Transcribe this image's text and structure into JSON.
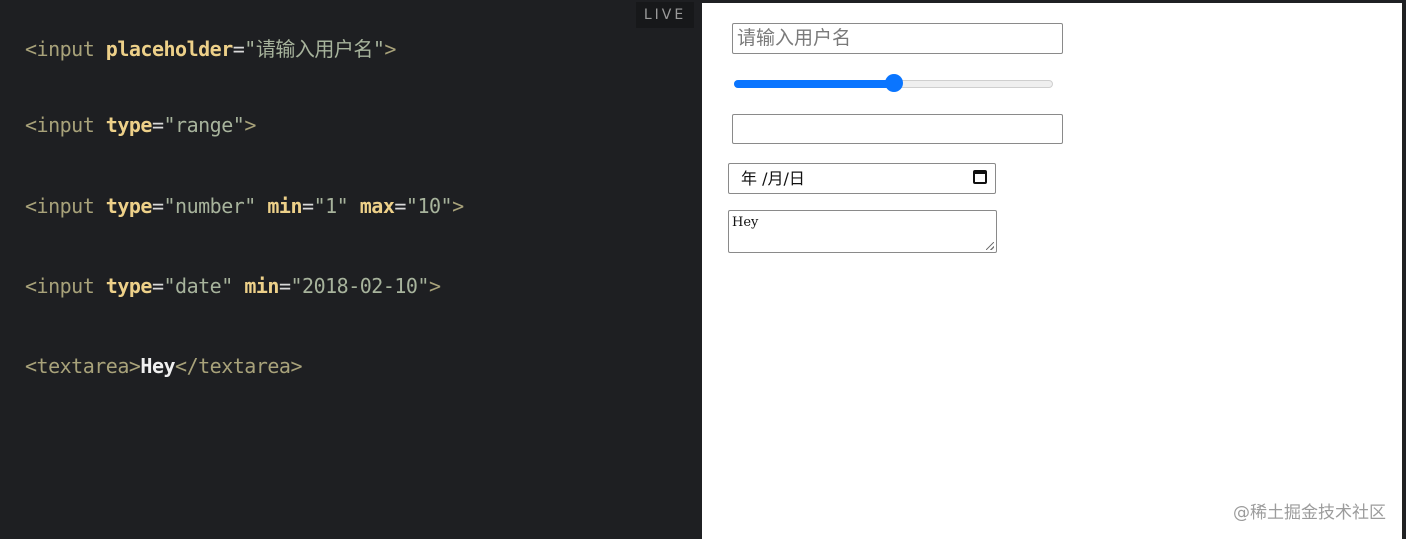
{
  "editor": {
    "lines": [
      {
        "open": "<input ",
        "attr1": "placeholder",
        "val1": "\"请输入用户名\"",
        "close": ">"
      },
      {
        "open": "<input ",
        "attr1": "type",
        "val1": "\"range\"",
        "close": ">"
      },
      {
        "open": "<input ",
        "attr1": "type",
        "val1": "\"number\"",
        "attr2": "min",
        "val2": "\"1\"",
        "attr3": "max",
        "val3": "\"10\"",
        "close": ">"
      },
      {
        "open": "<input ",
        "attr1": "type",
        "val1": "\"date\"",
        "attr2": "min",
        "val2": "\"2018-02-10\"",
        "close": ">"
      },
      {
        "open": "<textarea>",
        "text": "Hey",
        "close": "</textarea>"
      }
    ],
    "eq": "="
  },
  "live_label": "LIVE",
  "preview": {
    "text_placeholder": "请输入用户名",
    "range_value_percent": 50,
    "date_placeholder": "年 /月/日",
    "textarea_value": "Hey"
  },
  "watermark": "@稀土掘金技术社区",
  "colors": {
    "accent": "#0a75ff"
  }
}
